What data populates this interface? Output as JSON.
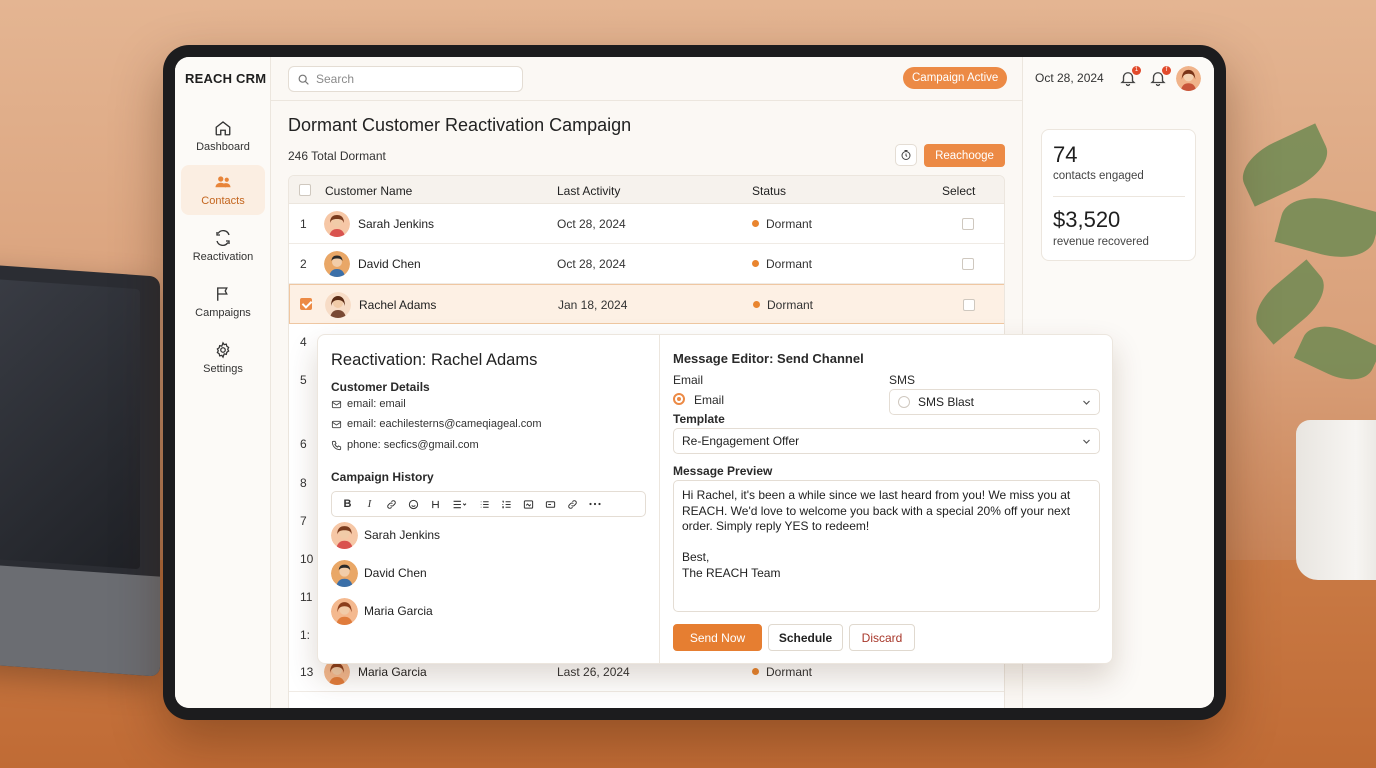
{
  "app": {
    "brand": "REACH CRM"
  },
  "sidebar": {
    "items": [
      {
        "label": "Dashboard",
        "icon": "home-icon"
      },
      {
        "label": "Contacts",
        "icon": "users-icon",
        "active": true
      },
      {
        "label": "Reactivation",
        "icon": "refresh-icon"
      },
      {
        "label": "Campaigns",
        "icon": "flag-icon"
      },
      {
        "label": "Settings",
        "icon": "gear-icon"
      }
    ]
  },
  "topbar": {
    "search_placeholder": "Search",
    "status_pill": "Campaign Active",
    "date": "Oct 28, 2024",
    "notifications": [
      {
        "badge": "1"
      },
      {
        "badge": "f"
      }
    ]
  },
  "stats": {
    "engaged_value": "74",
    "engaged_label": "contacts engaged",
    "revenue_value": "$3,520",
    "revenue_label": "revenue recovered"
  },
  "main": {
    "title": "Dormant Customer Reactivation Campaign",
    "total": "246 Total Dormant",
    "action_button": "Reachooge"
  },
  "table": {
    "headers": {
      "name": "Customer Name",
      "activity": "Last Activity",
      "status": "Status",
      "select": "Select"
    },
    "rows": [
      {
        "num": "1",
        "name": "Sarah Jenkins",
        "activity": "Oct 28, 2024",
        "status": "Dormant",
        "selected": false
      },
      {
        "num": "2",
        "name": "David Chen",
        "activity": "Oct 28, 2024",
        "status": "Dormant",
        "selected": false
      },
      {
        "num": "",
        "name": "Rachel Adams",
        "activity": "Jan 18, 2024",
        "status": "Dormant",
        "selected": true
      },
      {
        "num": "13",
        "name": "Maria Garcia",
        "activity": "Last 26, 2024",
        "status": "Dormant",
        "selected": false
      }
    ],
    "partial_row_numbers": [
      "4",
      "5",
      "6",
      "8",
      "7",
      "10",
      "11",
      "1:"
    ]
  },
  "popover": {
    "title": "Reactivation: Rachel Adams",
    "details_title": "Customer Details",
    "details": [
      {
        "icon": "mail-icon",
        "text": "email: email"
      },
      {
        "icon": "mail-icon",
        "text": "email: eachilesterns@cameqiageal.com"
      },
      {
        "icon": "phone-icon",
        "text": "phone: secfics@gmail.com"
      }
    ],
    "history_title": "Campaign History",
    "history": [
      "Sarah Jenkins",
      "David Chen",
      "Maria Garcia"
    ],
    "editor_title": "Message Editor: Send Channel",
    "channel_email_label": "Email",
    "channel_email_option": "Email",
    "channel_sms_label": "SMS",
    "channel_sms_option": "SMS Blast",
    "template_label": "Template",
    "template_value": "Re-Engagement Offer",
    "preview_label": "Message Preview",
    "preview_text": "Hi Rachel, it's been a while since we last heard from you! We miss you at REACH. We'd love to welcome you back with a special 20% off your next order. Simply reply YES to redeem!\n\nBest,\nThe REACH Team",
    "buttons": {
      "send": "Send Now",
      "schedule": "Schedule",
      "discard": "Discard"
    }
  },
  "colors": {
    "accent": "#ec8a45",
    "danger": "#a8382b"
  }
}
